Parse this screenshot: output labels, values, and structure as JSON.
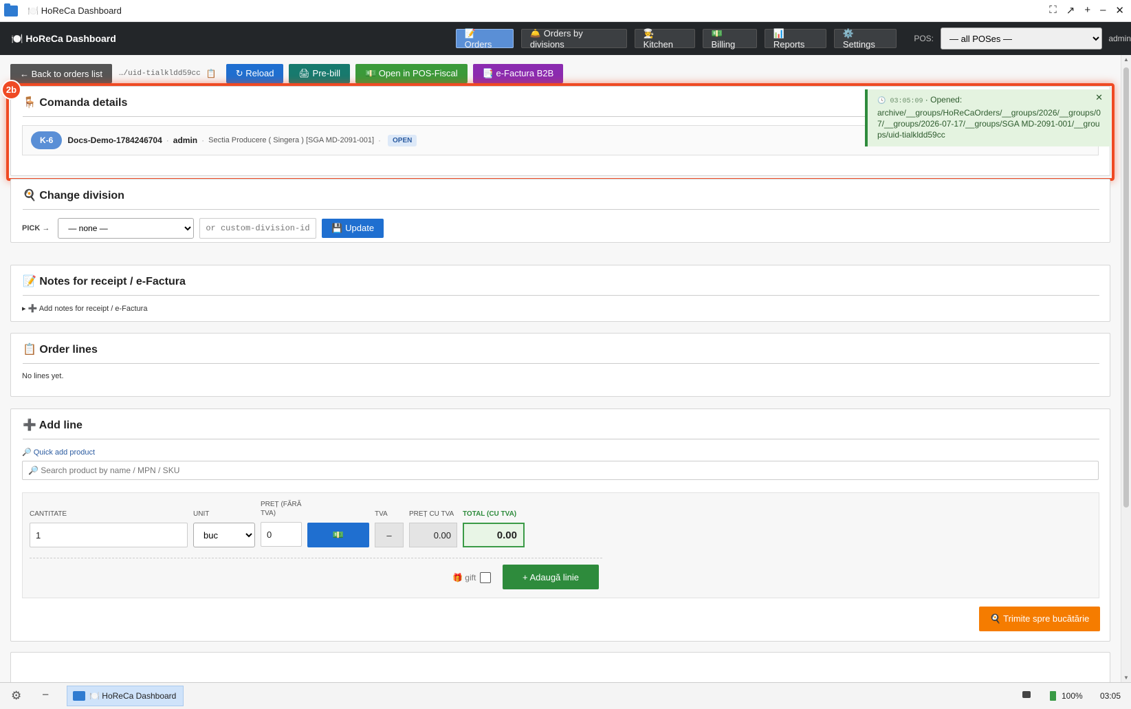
{
  "window": {
    "title": "🍽️ HoReCa Dashboard",
    "controls": [
      "⛶",
      "↗",
      "+",
      "–",
      "✕"
    ]
  },
  "appbar": {
    "brand": "🍽️ HoReCa Dashboard",
    "nav": [
      {
        "label": "📝 Orders",
        "active": true
      },
      {
        "label": "🛎️ Orders by divisions"
      },
      {
        "label": "🧑‍🍳 Kitchen"
      },
      {
        "label": "💵 Billing"
      },
      {
        "label": "📊 Reports"
      },
      {
        "label": "⚙️ Settings"
      }
    ],
    "pos_label": "POS:",
    "pos_value": "— all POSes —",
    "user": "admin"
  },
  "actions": {
    "back": "← Back to orders list",
    "crumb": "…/uid-tialkldd59cc",
    "clip": "📋",
    "reload": "↻ Reload",
    "prebill": "🖨 Pre-bill",
    "posfiscal": "💵 Open in POS-Fiscal",
    "efactura": "📑 e-Factura B2B",
    "colors": {
      "back": "#555555",
      "reload": "#1f6fd0",
      "prebill": "#177a6e",
      "posfiscal": "#3b9a3a",
      "efactura": "#8b2bb0"
    }
  },
  "step_badge": "2b",
  "comanda": {
    "title": "🪑 Comanda details",
    "k_badge": "K-6",
    "name": "Docs-Demo-1784246704",
    "user": "admin",
    "division": "Sectia Producere ( Singera ) [SGA MD-2091-001]",
    "status": "OPEN"
  },
  "toast": {
    "time": "🕓 03:05:09",
    "label": "Opened:",
    "path": "archive/__groups/HoReCaOrders/__groups/2026/__groups/07/__groups/2026-07-17/__groups/SGA MD-2091-001/__groups/uid-tialkldd59cc",
    "close": "✕"
  },
  "change_division": {
    "title": "🍳 Change division",
    "pick": "PICK →",
    "select_value": "— none —",
    "placeholder": "or custom-division-id",
    "update": "💾 Update"
  },
  "notes": {
    "title": "📝 Notes for receipt / e-Factura",
    "toggle": "▸ ➕ Add notes for receipt / e-Factura"
  },
  "order_lines": {
    "title": "📋 Order lines",
    "empty": "No lines yet."
  },
  "add_line": {
    "title": "➕ Add line",
    "quick": "🔎 Quick add product",
    "search_placeholder": "🔎 Search product by name / MPN / SKU",
    "qty_label": "CANTITATE",
    "qty": "1",
    "unit_label": "UNIT",
    "unit": "buc",
    "price_label": "PREȚ (FĂRĂ TVA)",
    "price": "0",
    "price_btn": "💵",
    "tva_label": "TVA",
    "tva": "–",
    "price_tva_label": "PREȚ CU TVA",
    "price_tva": "0.00",
    "total_label": "TOTAL (CU TVA)",
    "total": "0.00",
    "gift": "🎁 gift",
    "add_btn": "+ Adaugă linie",
    "send_btn": "🍳 Trimite spre bucătărie"
  },
  "taskbar": {
    "app": "🍽️ HoReCa Dashboard",
    "battery": "100%",
    "clock": "03:05"
  }
}
